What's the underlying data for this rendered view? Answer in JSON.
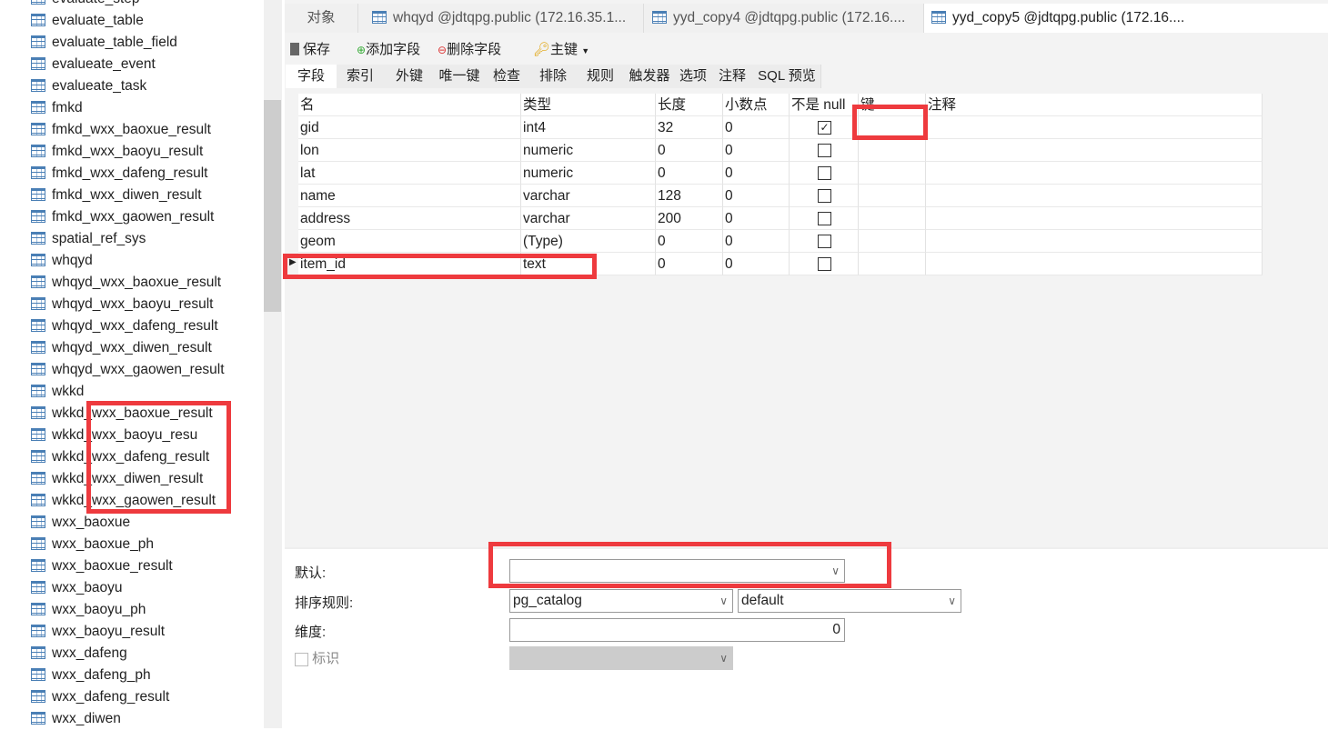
{
  "sidebar": {
    "items": [
      "evaluate_step",
      "evaluate_table",
      "evaluate_table_field",
      "evalueate_event",
      "evalueate_task",
      "fmkd",
      "fmkd_wxx_baoxue_result",
      "fmkd_wxx_baoyu_result",
      "fmkd_wxx_dafeng_result",
      "fmkd_wxx_diwen_result",
      "fmkd_wxx_gaowen_result",
      "spatial_ref_sys",
      "whqyd",
      "whqyd_wxx_baoxue_result",
      "whqyd_wxx_baoyu_result",
      "whqyd_wxx_dafeng_result",
      "whqyd_wxx_diwen_result",
      "whqyd_wxx_gaowen_result",
      "wkkd",
      "wkkd_wxx_baoxue_result",
      "wkkd_wxx_baoyu_resu",
      "wkkd_wxx_dafeng_result",
      "wkkd_wxx_diwen_result",
      "wkkd_wxx_gaowen_result",
      "wxx_baoxue",
      "wxx_baoxue_ph",
      "wxx_baoxue_result",
      "wxx_baoyu",
      "wxx_baoyu_ph",
      "wxx_baoyu_result",
      "wxx_dafeng",
      "wxx_dafeng_ph",
      "wxx_dafeng_result",
      "wxx_diwen"
    ]
  },
  "tabs": [
    "对象",
    "whqyd @jdtqpg.public (172.16.35.1...",
    "yyd_copy4 @jdtqpg.public (172.16....",
    "yyd_copy5 @jdtqpg.public (172.16...."
  ],
  "toolbar": {
    "save": "保存",
    "add_field": "添加字段",
    "delete_field": "删除字段",
    "primary_key": "主键"
  },
  "subtabs": [
    "字段",
    "索引",
    "外键",
    "唯一键",
    "检查",
    "排除",
    "规则",
    "触发器",
    "选项",
    "注释",
    "SQL 预览"
  ],
  "grid": {
    "columns": [
      "名",
      "类型",
      "长度",
      "小数点",
      "不是 null",
      "键",
      "注释"
    ],
    "rows": [
      {
        "name": "gid",
        "type": "int4",
        "length": "32",
        "decimal": "0",
        "not_null": true
      },
      {
        "name": "lon",
        "type": "numeric",
        "length": "0",
        "decimal": "0",
        "not_null": false
      },
      {
        "name": "lat",
        "type": "numeric",
        "length": "0",
        "decimal": "0",
        "not_null": false
      },
      {
        "name": "name",
        "type": "varchar",
        "length": "128",
        "decimal": "0",
        "not_null": false
      },
      {
        "name": "address",
        "type": "varchar",
        "length": "200",
        "decimal": "0",
        "not_null": false
      },
      {
        "name": "geom",
        "type": "(Type)",
        "length": "0",
        "decimal": "0",
        "not_null": false
      },
      {
        "name": "item_id",
        "type": "text",
        "length": "0",
        "decimal": "0",
        "not_null": false
      }
    ]
  },
  "props": {
    "default_label": "默认:",
    "default_value": "",
    "collation_label": "排序规则:",
    "collation_schema": "pg_catalog",
    "collation_name": "default",
    "dimension_label": "维度:",
    "dimension_value": "0",
    "identity_label": "标识"
  },
  "colors": {
    "highlight": "#ee3a3e",
    "icon": "#4a7fb5"
  }
}
